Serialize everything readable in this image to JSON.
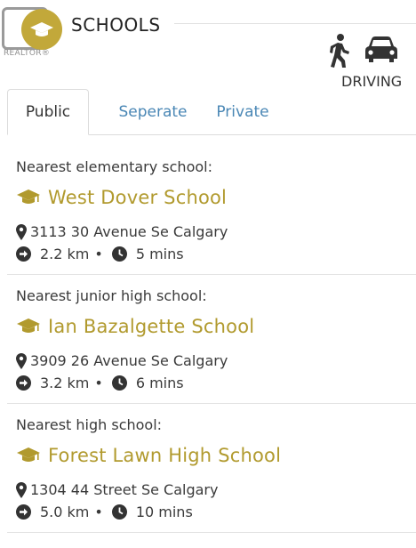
{
  "brand": {
    "logo_text": "REALTOR®",
    "accent": "#c2a83a"
  },
  "header": {
    "title": "SCHOOLS",
    "mode_label": "DRIVING"
  },
  "tabs": [
    {
      "label": "Public",
      "active": true
    },
    {
      "label": "Seperate",
      "active": false
    },
    {
      "label": "Private",
      "active": false
    }
  ],
  "schools": [
    {
      "level": "Nearest elementary school:",
      "name": "West Dover School",
      "address": "3113 30 Avenue Se Calgary",
      "distance": "2.2 km",
      "time": "5 mins"
    },
    {
      "level": "Nearest junior high school:",
      "name": "Ian Bazalgette School",
      "address": "3909 26 Avenue Se Calgary",
      "distance": "3.2 km",
      "time": "6 mins"
    },
    {
      "level": "Nearest high school:",
      "name": "Forest Lawn High School",
      "address": "1304 44 Street Se Calgary",
      "distance": "5.0 km",
      "time": "10 mins"
    }
  ],
  "separator": "•",
  "colors": {
    "school_name": "#b19a2e",
    "tab_link": "#4a87b5",
    "text": "#3a3a3a"
  },
  "icons": {
    "walk": "walking-person-icon",
    "drive": "car-icon",
    "school": "graduation-cap-icon",
    "address": "map-marker-icon",
    "distance": "arrow-circle-right-icon",
    "time": "clock-icon"
  }
}
